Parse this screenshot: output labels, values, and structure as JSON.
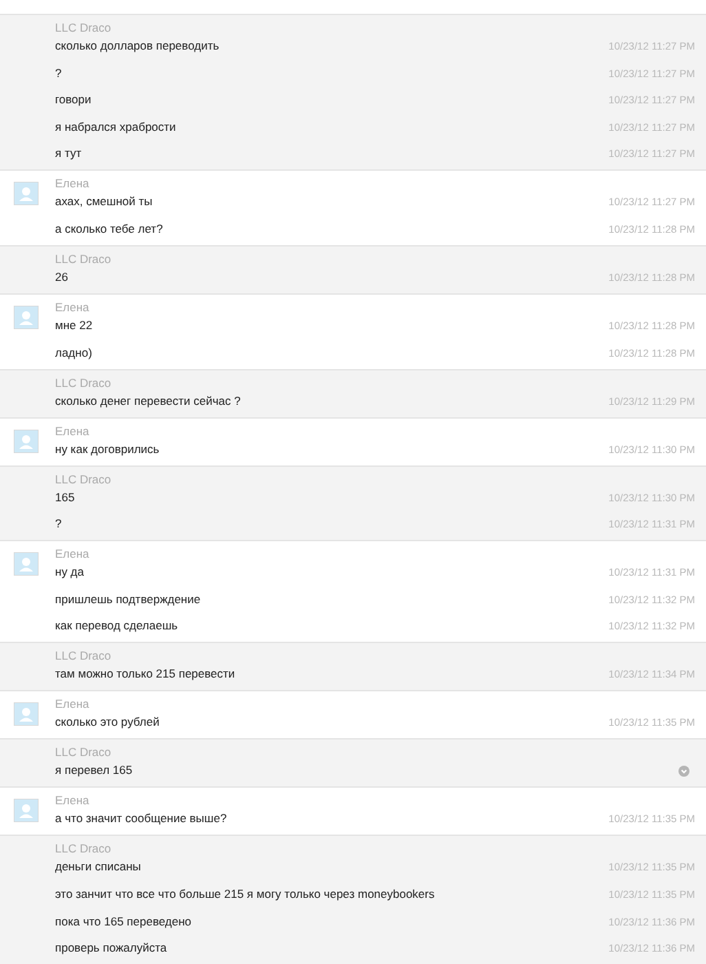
{
  "groups": [
    {
      "kind": "draco",
      "sender": "LLC Draco",
      "messages": [
        {
          "kind": "timed",
          "text": "сколько долларов переводить",
          "time": "10/23/12 11:27 PM"
        },
        {
          "kind": "timed",
          "text": "?",
          "time": "10/23/12 11:27 PM"
        },
        {
          "kind": "timed",
          "text": "говори",
          "time": "10/23/12 11:27 PM"
        },
        {
          "kind": "timed",
          "text": "я набрался храбрости",
          "time": "10/23/12 11:27 PM"
        },
        {
          "kind": "timed",
          "text": "я тут",
          "time": "10/23/12 11:27 PM"
        }
      ]
    },
    {
      "kind": "elena",
      "sender": "Елена",
      "messages": [
        {
          "kind": "timed",
          "text": "ахах, смешной ты",
          "time": "10/23/12 11:27 PM"
        },
        {
          "kind": "timed",
          "text": "а сколько тебе лет?",
          "time": "10/23/12 11:28 PM"
        }
      ]
    },
    {
      "kind": "draco",
      "sender": "LLC Draco",
      "messages": [
        {
          "kind": "timed",
          "text": "26",
          "time": "10/23/12 11:28 PM"
        }
      ]
    },
    {
      "kind": "elena",
      "sender": "Елена",
      "messages": [
        {
          "kind": "timed",
          "text": "мне 22",
          "time": "10/23/12 11:28 PM"
        },
        {
          "kind": "timed",
          "text": "ладно)",
          "time": "10/23/12 11:28 PM"
        }
      ]
    },
    {
      "kind": "draco",
      "sender": "LLC Draco",
      "messages": [
        {
          "kind": "timed",
          "text": "сколько денег перевести сейчас ?",
          "time": "10/23/12 11:29 PM"
        }
      ]
    },
    {
      "kind": "elena",
      "sender": "Елена",
      "messages": [
        {
          "kind": "timed",
          "text": "ну как договрились",
          "time": "10/23/12 11:30 PM"
        }
      ]
    },
    {
      "kind": "draco",
      "sender": "LLC Draco",
      "messages": [
        {
          "kind": "timed",
          "text": "165",
          "time": "10/23/12 11:30 PM"
        },
        {
          "kind": "timed",
          "text": "?",
          "time": "10/23/12 11:31 PM"
        }
      ]
    },
    {
      "kind": "elena",
      "sender": "Елена",
      "messages": [
        {
          "kind": "timed",
          "text": "ну да",
          "time": "10/23/12 11:31 PM"
        },
        {
          "kind": "timed",
          "text": "пришлешь подтверждение",
          "time": "10/23/12 11:32 PM"
        },
        {
          "kind": "timed",
          "text": "как перевод сделаешь",
          "time": "10/23/12 11:32 PM"
        }
      ]
    },
    {
      "kind": "draco",
      "sender": "LLC Draco",
      "messages": [
        {
          "kind": "timed",
          "text": "там можно только 215 перевести",
          "time": "10/23/12 11:34 PM"
        }
      ]
    },
    {
      "kind": "elena",
      "sender": "Елена",
      "messages": [
        {
          "kind": "timed",
          "text": "сколько это рублей",
          "time": "10/23/12 11:35 PM"
        }
      ]
    },
    {
      "kind": "draco",
      "sender": "LLC Draco",
      "messages": [
        {
          "kind": "pending",
          "text": "я перевел 165"
        }
      ]
    },
    {
      "kind": "elena",
      "sender": "Елена",
      "messages": [
        {
          "kind": "timed",
          "text": "а что значит сообщение выше?",
          "time": "10/23/12 11:35 PM"
        }
      ]
    },
    {
      "kind": "draco",
      "sender": "LLC Draco",
      "messages": [
        {
          "kind": "timed",
          "text": "деньги списаны",
          "time": "10/23/12 11:35 PM"
        },
        {
          "kind": "timed",
          "text": "это занчит что все что больше 215 я могу только через moneybookers",
          "time": "10/23/12 11:35 PM"
        },
        {
          "kind": "timed",
          "text": "пока что 165 переведено",
          "time": "10/23/12 11:36 PM"
        },
        {
          "kind": "timed",
          "text": "проверь пожалуйста",
          "time": "10/23/12 11:36 PM"
        }
      ]
    }
  ]
}
